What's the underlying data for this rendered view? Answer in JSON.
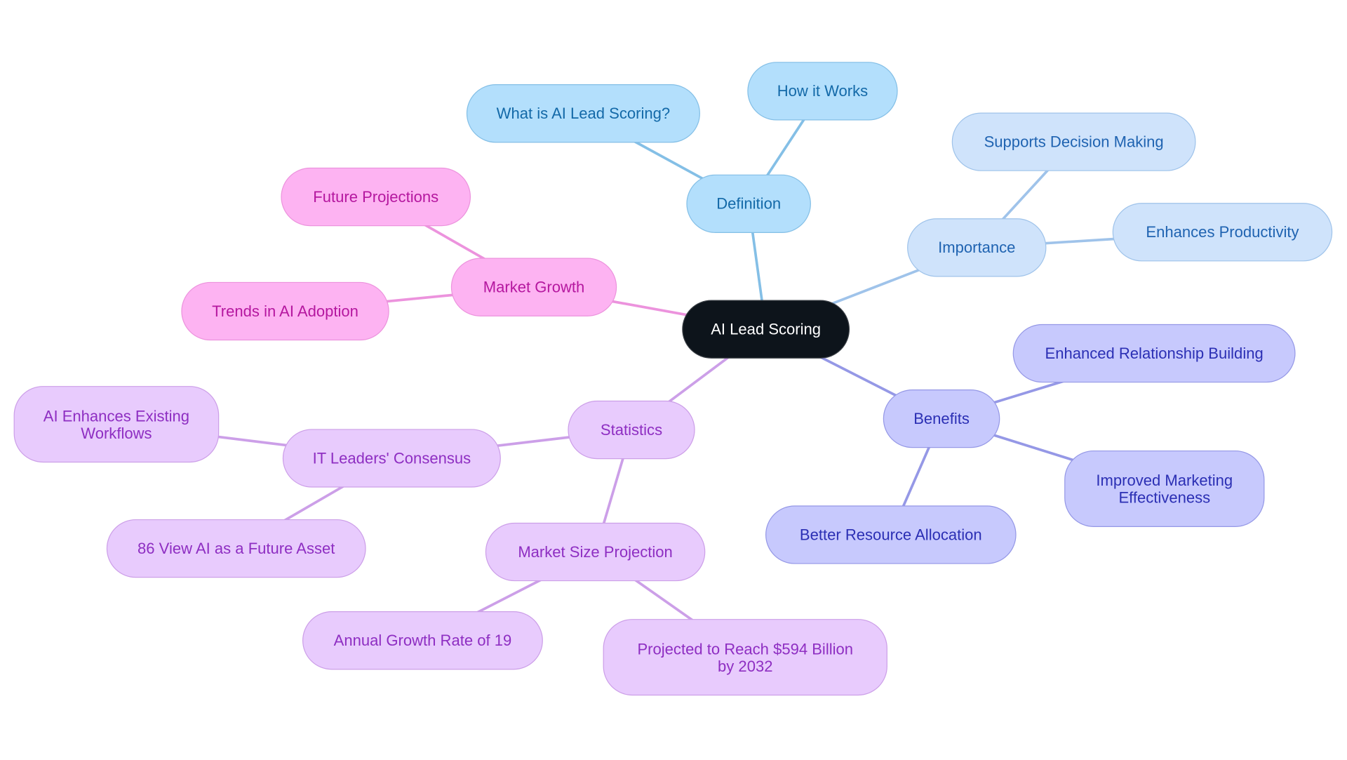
{
  "diagram": {
    "type": "mindmap",
    "root": {
      "id": "root",
      "label": "AI Lead Scoring"
    },
    "branch_colors": {
      "definition": "#84bfe6",
      "importance": "#9fc3ea",
      "benefits": "#9598e6",
      "market_growth": "#ec93dd",
      "statistics": "#cc9fe8"
    },
    "nodes": {
      "definition": {
        "label": "Definition",
        "parent": "root",
        "branch": "definition"
      },
      "what_is": {
        "label": "What is AI Lead Scoring?",
        "parent": "definition",
        "branch": "definition"
      },
      "how_it_works": {
        "label": "How it Works",
        "parent": "definition",
        "branch": "definition"
      },
      "importance": {
        "label": "Importance",
        "parent": "root",
        "branch": "importance"
      },
      "supports_decision": {
        "label": "Supports Decision Making",
        "parent": "importance",
        "branch": "importance"
      },
      "enhances_productivity": {
        "label": "Enhances Productivity",
        "parent": "importance",
        "branch": "importance"
      },
      "benefits": {
        "label": "Benefits",
        "parent": "root",
        "branch": "benefits"
      },
      "relationship": {
        "label": "Enhanced Relationship Building",
        "parent": "benefits",
        "branch": "benefits"
      },
      "marketing": {
        "label": "Improved Marketing Effectiveness",
        "parent": "benefits",
        "branch": "benefits"
      },
      "resource": {
        "label": "Better Resource Allocation",
        "parent": "benefits",
        "branch": "benefits"
      },
      "market_growth": {
        "label": "Market Growth",
        "parent": "root",
        "branch": "market_growth"
      },
      "future_projections": {
        "label": "Future Projections",
        "parent": "market_growth",
        "branch": "market_growth"
      },
      "trends": {
        "label": "Trends in AI Adoption",
        "parent": "market_growth",
        "branch": "market_growth"
      },
      "statistics": {
        "label": "Statistics",
        "parent": "root",
        "branch": "statistics"
      },
      "it_leaders": {
        "label": "IT Leaders' Consensus",
        "parent": "statistics",
        "branch": "statistics"
      },
      "ai_enhances": {
        "label": "AI Enhances Existing Workflows",
        "parent": "it_leaders",
        "branch": "statistics"
      },
      "view_ai": {
        "label": "86 View AI as a Future Asset",
        "parent": "it_leaders",
        "branch": "statistics"
      },
      "market_size": {
        "label": "Market Size Projection",
        "parent": "statistics",
        "branch": "statistics"
      },
      "annual_growth": {
        "label": "Annual Growth Rate of 19",
        "parent": "market_size",
        "branch": "statistics"
      },
      "projected": {
        "label": "Projected to Reach $594 Billion by 2032",
        "parent": "market_size",
        "branch": "statistics"
      }
    }
  }
}
